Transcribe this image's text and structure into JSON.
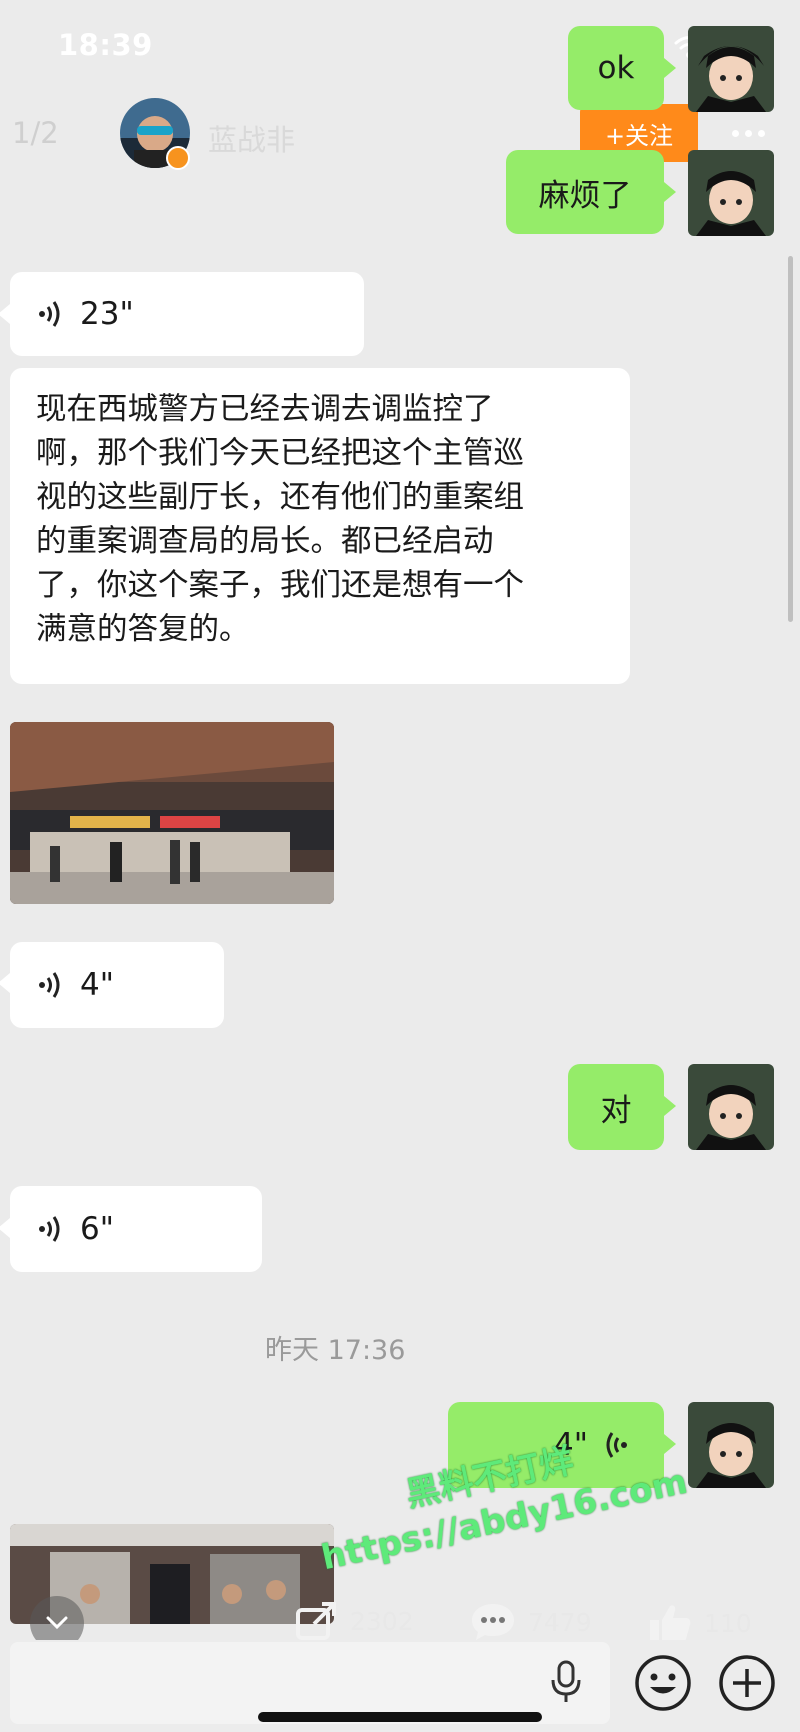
{
  "status_bar": {
    "time": "18:39"
  },
  "header": {
    "pager": "1/2",
    "contact_name": "蓝战非",
    "follow_label": "+关注"
  },
  "messages": {
    "m1": "ok",
    "m2": "麻烦了",
    "m3_voice": "23\"",
    "m4_lines": [
      "现在西城警方已经去调去调监控了",
      "啊，那个我们今天已经把这个主管巡",
      "视的这些副厅长，还有他们的重案组",
      "的重案调查局的局长。都已经启动",
      "了，你这个案子，我们还是想有一个",
      "满意的答复的。"
    ],
    "m6_voice": "4\"",
    "m7": "对",
    "m8_voice": "6\"",
    "timestamp": "昨天 17:36",
    "m9_voice": "4\""
  },
  "watermark": {
    "line1": "黑料不打烊",
    "line2": "https://abdy16.com"
  },
  "stats": {
    "shares": "2302",
    "comments": "7479",
    "likes": "110"
  },
  "colors": {
    "sent_bubble": "#95ec69",
    "received_bubble": "#ffffff",
    "follow_button": "#ff8a1a",
    "background": "#ebebeb"
  }
}
